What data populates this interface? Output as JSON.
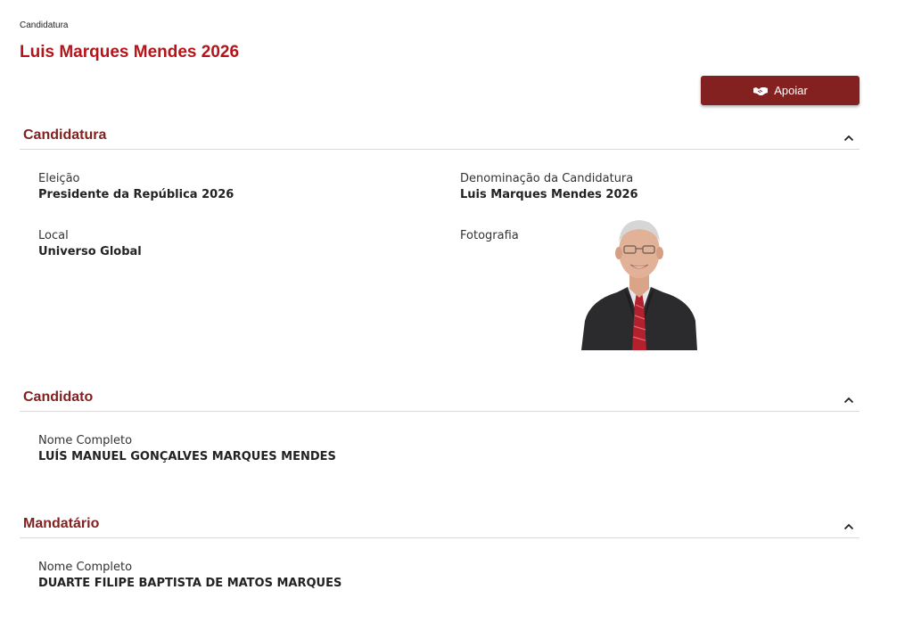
{
  "breadcrumb": "Candidatura",
  "page_title": "Luis Marques Mendes 2026",
  "apoiar_button": {
    "label": "Apoiar",
    "icon": "handshake-icon"
  },
  "colors": {
    "title_red": "#b5141a",
    "section_maroon": "#832121",
    "button_bg": "#832121"
  },
  "sections": {
    "candidatura": {
      "title": "Candidatura",
      "eleicao_label": "Eleição",
      "eleicao_value": "Presidente da República 2026",
      "denominacao_label": "Denominação da Candidatura",
      "denominacao_value": "Luis Marques Mendes 2026",
      "local_label": "Local",
      "local_value": "Universo Global",
      "fotografia_label": "Fotografia"
    },
    "candidato": {
      "title": "Candidato",
      "nome_label": "Nome Completo",
      "nome_value": "LUÍS MANUEL GONÇALVES MARQUES MENDES"
    },
    "mandatario": {
      "title": "Mandatário",
      "nome_label": "Nome Completo",
      "nome_value": "DUARTE FILIPE BAPTISTA DE MATOS MARQUES"
    }
  }
}
